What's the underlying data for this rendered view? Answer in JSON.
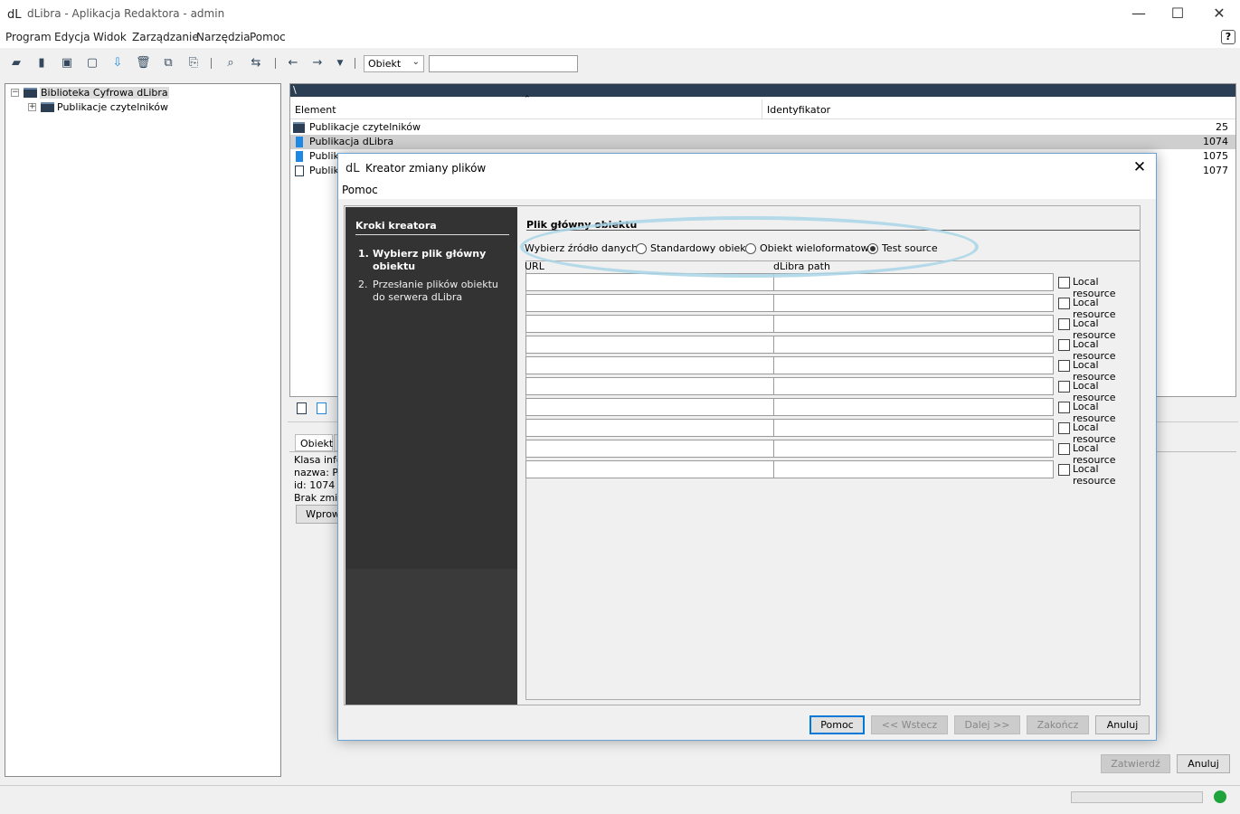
{
  "window": {
    "title": "dLibra - Aplikacja Redaktora - admin"
  },
  "menu": [
    "Program",
    "Edycja",
    "Widok",
    "Zarządzanie",
    "Narzędzia",
    "Pomoc"
  ],
  "toolbar": {
    "select_value": "Obiekt",
    "search_value": ""
  },
  "tree": {
    "root": "Biblioteka Cyfrowa dLibra",
    "child": "Publikacje czytelników"
  },
  "table": {
    "path": "\\",
    "columns": [
      "Element",
      "Identyfikator"
    ],
    "rows": [
      {
        "name": "Publikacje czytelników",
        "id": "25"
      },
      {
        "name": "Publikacja dLibra",
        "id": "1074"
      },
      {
        "name": "Publika",
        "id": "1075"
      },
      {
        "name": "Publika",
        "id": "1077"
      }
    ]
  },
  "details": {
    "tab": "Obiekt",
    "lines": [
      "Klasa info",
      "nazwa: Pu",
      "id: 1074",
      "Brak zmian"
    ],
    "button": "Wprow"
  },
  "bottom_buttons": {
    "confirm": "Zatwierdź",
    "cancel": "Anuluj"
  },
  "dialog": {
    "title": "Kreator zmiany plików",
    "menu": "Pomoc",
    "steps_header": "Kroki kreatora",
    "steps": [
      {
        "num": "1.",
        "label": "Wybierz plik główny obiektu",
        "active": true
      },
      {
        "num": "2.",
        "label": "Przesłanie plików obiektu do serwera dLibra",
        "active": false
      }
    ],
    "section_title": "Plik główny obiektu",
    "source_label": "Wybierz źródło danych:",
    "sources": [
      {
        "label": "Standardowy obiekt",
        "selected": false
      },
      {
        "label": "Obiekt wieloformatowy",
        "selected": false
      },
      {
        "label": "Test source",
        "selected": true
      }
    ],
    "grid_headers": {
      "url": "URL",
      "path": "dLibra path"
    },
    "row_count": 10,
    "checkbox_label": "Local resource",
    "buttons": {
      "help": "Pomoc",
      "back": "<< Wstecz",
      "next": "Dalej >>",
      "finish": "Zakończ",
      "cancel": "Anuluj"
    }
  },
  "colors": {
    "highlight": "#a9d5e8",
    "status_led": "#1fa33a",
    "folder": "#2b3e54"
  }
}
